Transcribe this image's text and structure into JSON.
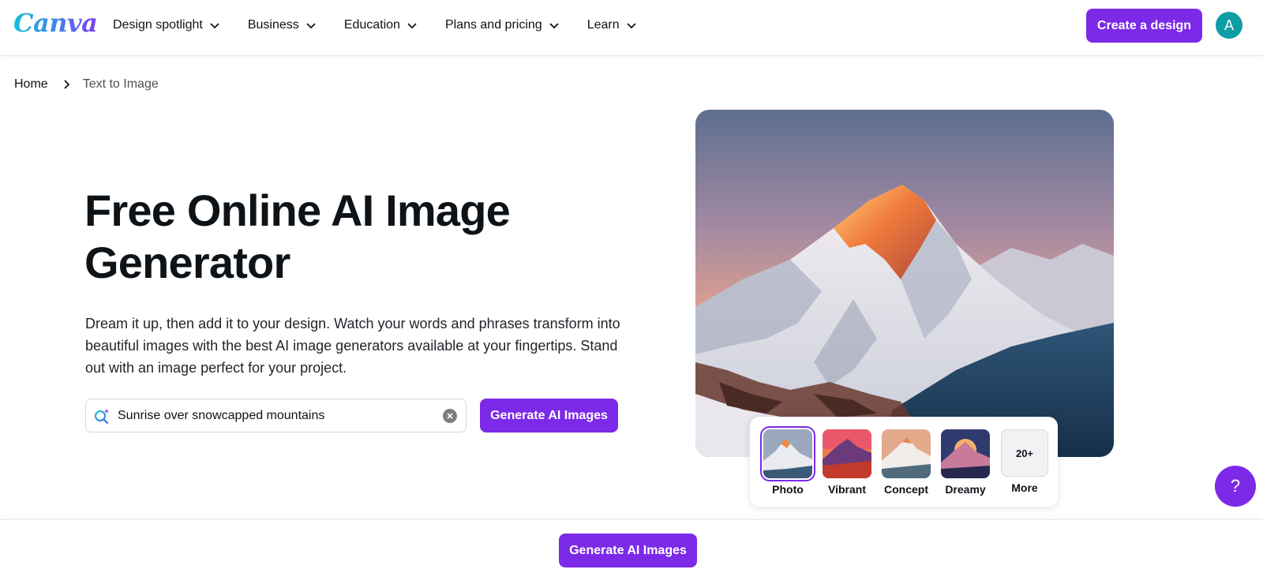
{
  "header": {
    "logo": "Canva",
    "nav": [
      {
        "label": "Design spotlight"
      },
      {
        "label": "Business"
      },
      {
        "label": "Education"
      },
      {
        "label": "Plans and pricing"
      },
      {
        "label": "Learn"
      }
    ],
    "create_button": "Create a design",
    "avatar_initial": "A"
  },
  "breadcrumb": {
    "home": "Home",
    "current": "Text to Image"
  },
  "hero": {
    "title": "Free Online AI Image Generator",
    "description": "Dream it up, then add it to your design. Watch your words and phrases transform into beautiful images with the best AI image generators available at your fingertips. Stand out with an image perfect for your project.",
    "search_value": "Sunrise over snowcapped mountains",
    "generate_button": "Generate AI Images"
  },
  "styles": {
    "options": [
      {
        "label": "Photo",
        "selected": true
      },
      {
        "label": "Vibrant",
        "selected": false
      },
      {
        "label": "Concept",
        "selected": false
      },
      {
        "label": "Dreamy",
        "selected": false
      }
    ],
    "more_badge": "20+",
    "more_label": "More"
  },
  "help": {
    "label": "?"
  },
  "bottom_bar": {
    "generate_button": "Generate AI Images"
  },
  "colors": {
    "accent": "#7d2ae8",
    "avatar": "#0e9ca5"
  }
}
